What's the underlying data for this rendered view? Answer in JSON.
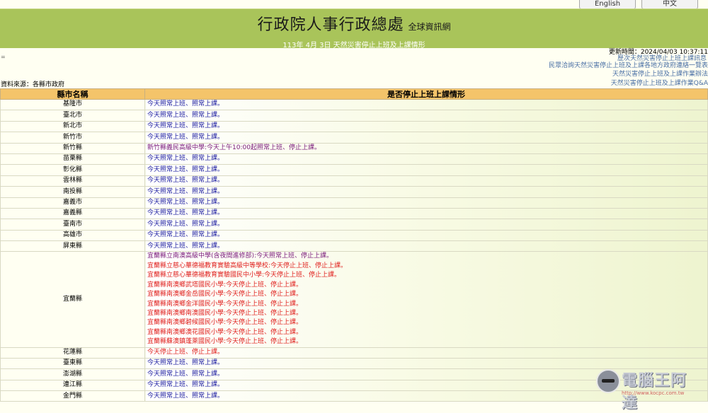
{
  "lang": {
    "english": "English",
    "chinese": "中文"
  },
  "header": {
    "title": "行政院人事行政總處",
    "subtitle": "全球資訊網",
    "date_line": "113年 4月 3日  天然災害停止上班及上課情形"
  },
  "menu_glyph": "=",
  "update_time": "更新時間：2024/04/03 10:37:11",
  "side_links": {
    "history": "歷次天然災害停止上班上課訊息",
    "contact": "民眾洽詢天然災害停止上班及上課各地方政府連絡一覽表",
    "rules": "天然災害停止上班及上課作業辦法",
    "qa": "天然災害停止上班及上課作業Q&A"
  },
  "source_line": "資料來源：各縣市政府",
  "table": {
    "headers": {
      "county": "縣市名稱",
      "status": "是否停止上班上課情形"
    },
    "rows": [
      {
        "county": "基隆市",
        "lines": [
          {
            "text": "今天照常上班、照常上課。",
            "tone": "normal"
          }
        ]
      },
      {
        "county": "臺北市",
        "lines": [
          {
            "text": "今天照常上班、照常上課。",
            "tone": "normal"
          }
        ]
      },
      {
        "county": "新北市",
        "lines": [
          {
            "text": "今天照常上班、照常上課。",
            "tone": "normal"
          }
        ]
      },
      {
        "county": "新竹市",
        "lines": [
          {
            "text": "今天照常上班、照常上課。",
            "tone": "normal"
          }
        ]
      },
      {
        "county": "新竹縣",
        "lines": [
          {
            "text": "新竹縣義民高級中學:今天上午10:00起照常上班、停止上課。",
            "tone": "purple"
          }
        ]
      },
      {
        "county": "苗栗縣",
        "lines": [
          {
            "text": "今天照常上班、照常上課。",
            "tone": "normal"
          }
        ]
      },
      {
        "county": "彰化縣",
        "lines": [
          {
            "text": "今天照常上班、照常上課。",
            "tone": "normal"
          }
        ]
      },
      {
        "county": "雲林縣",
        "lines": [
          {
            "text": "今天照常上班、照常上課。",
            "tone": "normal"
          }
        ]
      },
      {
        "county": "南投縣",
        "lines": [
          {
            "text": "今天照常上班、照常上課。",
            "tone": "normal"
          }
        ]
      },
      {
        "county": "嘉義市",
        "lines": [
          {
            "text": "今天照常上班、照常上課。",
            "tone": "normal"
          }
        ]
      },
      {
        "county": "嘉義縣",
        "lines": [
          {
            "text": "今天照常上班、照常上課。",
            "tone": "normal"
          }
        ]
      },
      {
        "county": "臺南市",
        "lines": [
          {
            "text": "今天照常上班、照常上課。",
            "tone": "normal"
          }
        ]
      },
      {
        "county": "高雄市",
        "lines": [
          {
            "text": "今天照常上班、照常上課。",
            "tone": "normal"
          }
        ]
      },
      {
        "county": "屏東縣",
        "lines": [
          {
            "text": "今天照常上班、照常上課。",
            "tone": "normal"
          }
        ]
      },
      {
        "county": "宜蘭縣",
        "lines": [
          {
            "text": "宜蘭縣立南澳高級中學(含夜間進修部):今天照常上班、停止上課。",
            "tone": "purple"
          },
          {
            "text": "宜蘭縣立慈心華德福教育實驗高級中等學校:今天停止上班、停止上課。",
            "tone": "red"
          },
          {
            "text": "宜蘭縣立慈心華德福教育實驗國民中小學:今天停止上班、停止上課。",
            "tone": "red"
          },
          {
            "text": "宜蘭縣南澳鄉武塔國民小學:今天停止上班、停止上課。",
            "tone": "red"
          },
          {
            "text": "宜蘭縣南澳鄉金岳國民小學:今天停止上班、停止上課。",
            "tone": "red"
          },
          {
            "text": "宜蘭縣南澳鄉金洋國民小學:今天停止上班、停止上課。",
            "tone": "red"
          },
          {
            "text": "宜蘭縣南澳鄉南澳國民小學:今天停止上班、停止上課。",
            "tone": "red"
          },
          {
            "text": "宜蘭縣南澳鄉碧候國民小學:今天停止上班、停止上課。",
            "tone": "red"
          },
          {
            "text": "宜蘭縣南澳鄉澳花國民小學:今天停止上班、停止上課。",
            "tone": "red"
          },
          {
            "text": "宜蘭縣蘇澳鎮蓬萊國民小學:今天停止上班、停止上課。",
            "tone": "red"
          }
        ]
      },
      {
        "county": "花蓮縣",
        "lines": [
          {
            "text": "今天停止上班、停止上課。",
            "tone": "red"
          }
        ]
      },
      {
        "county": "臺東縣",
        "lines": [
          {
            "text": "今天照常上班、照常上課。",
            "tone": "normal"
          }
        ]
      },
      {
        "county": "澎湖縣",
        "lines": [
          {
            "text": "今天照常上班、照常上課。",
            "tone": "normal"
          }
        ]
      },
      {
        "county": "連江縣",
        "lines": [
          {
            "text": "今天照常上班、照常上課。",
            "tone": "normal"
          }
        ]
      },
      {
        "county": "金門縣",
        "lines": [
          {
            "text": "今天照常上班、照常上課。",
            "tone": "normal"
          }
        ]
      }
    ]
  },
  "watermark": {
    "brand": "電腦王阿達",
    "url": "http://www.kocpc.com.tw"
  },
  "colors": {
    "banner": "#a9c45a",
    "header_row": "#f4c46a",
    "normal": "#1a1aa0",
    "purple": "#7a1a7a",
    "red": "#e0201e"
  }
}
